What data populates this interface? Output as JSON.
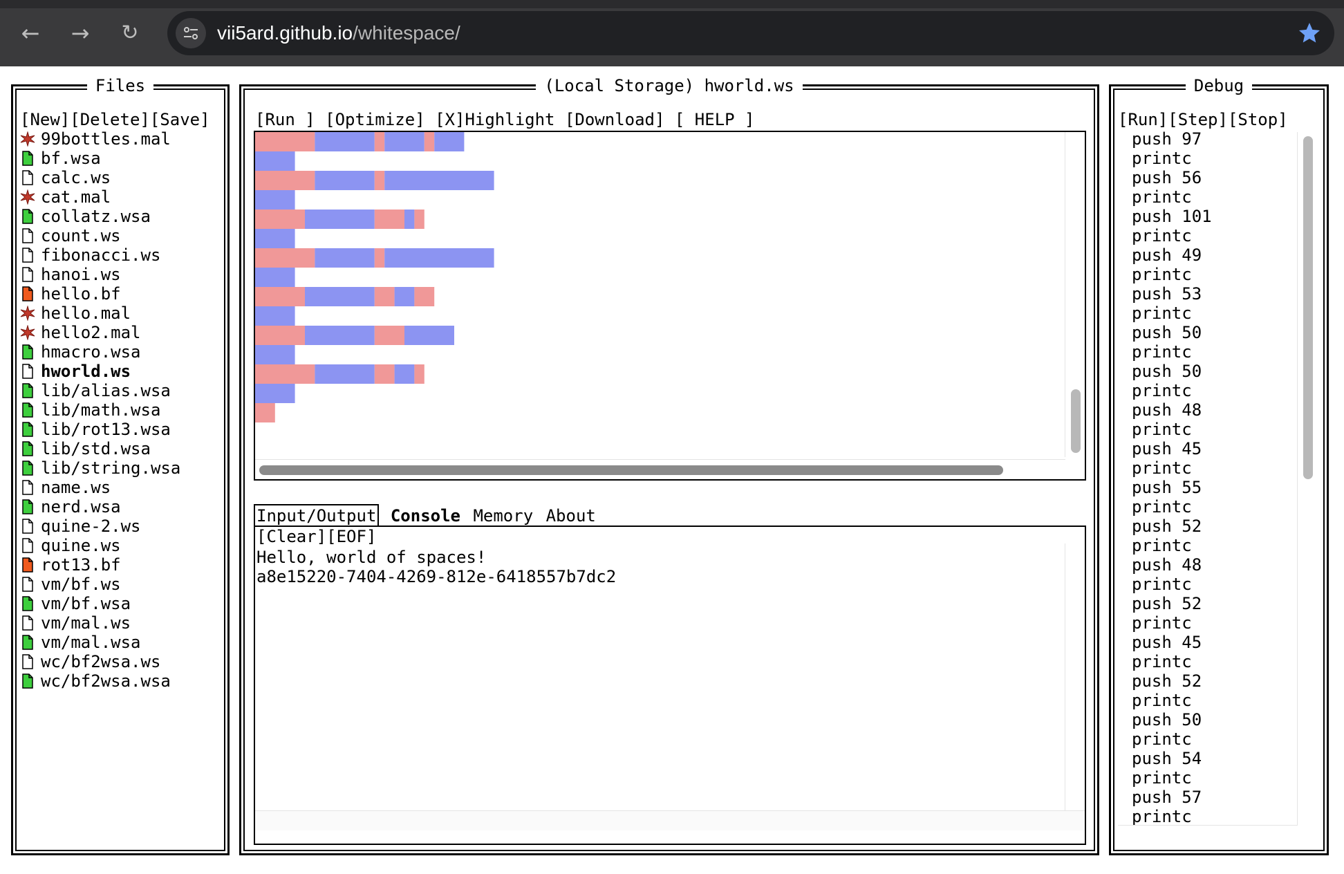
{
  "browser": {
    "url_host": "vii5ard.github.io",
    "url_path": "/whitespace/"
  },
  "files_panel": {
    "title": "Files",
    "toolbar": {
      "new": "[New]",
      "delete": "[Delete]",
      "save": "[Save]"
    },
    "items": [
      {
        "name": "99bottles.mal",
        "icon": "mal-star-icon"
      },
      {
        "name": "bf.wsa",
        "icon": "green-file-icon"
      },
      {
        "name": "calc.ws",
        "icon": "blank-file-icon"
      },
      {
        "name": "cat.mal",
        "icon": "mal-star-icon"
      },
      {
        "name": "collatz.wsa",
        "icon": "green-file-icon"
      },
      {
        "name": "count.ws",
        "icon": "blank-file-icon"
      },
      {
        "name": "fibonacci.ws",
        "icon": "blank-file-icon"
      },
      {
        "name": "hanoi.ws",
        "icon": "blank-file-icon"
      },
      {
        "name": "hello.bf",
        "icon": "orange-file-icon"
      },
      {
        "name": "hello.mal",
        "icon": "mal-star-icon"
      },
      {
        "name": "hello2.mal",
        "icon": "mal-star-icon"
      },
      {
        "name": "hmacro.wsa",
        "icon": "green-file-icon"
      },
      {
        "name": "hworld.ws",
        "icon": "blank-file-icon",
        "active": true
      },
      {
        "name": "lib/alias.wsa",
        "icon": "green-file-icon"
      },
      {
        "name": "lib/math.wsa",
        "icon": "green-file-icon"
      },
      {
        "name": "lib/rot13.wsa",
        "icon": "green-file-icon"
      },
      {
        "name": "lib/std.wsa",
        "icon": "green-file-icon"
      },
      {
        "name": "lib/string.wsa",
        "icon": "green-file-icon"
      },
      {
        "name": "name.ws",
        "icon": "blank-file-icon"
      },
      {
        "name": "nerd.wsa",
        "icon": "green-file-icon"
      },
      {
        "name": "quine-2.ws",
        "icon": "blank-file-icon"
      },
      {
        "name": "quine.ws",
        "icon": "blank-file-icon"
      },
      {
        "name": "rot13.bf",
        "icon": "orange-file-icon"
      },
      {
        "name": "vm/bf.ws",
        "icon": "blank-file-icon"
      },
      {
        "name": "vm/bf.wsa",
        "icon": "green-file-icon"
      },
      {
        "name": "vm/mal.ws",
        "icon": "blank-file-icon"
      },
      {
        "name": "vm/mal.wsa",
        "icon": "green-file-icon"
      },
      {
        "name": "wc/bf2wsa.ws",
        "icon": "blank-file-icon"
      },
      {
        "name": "wc/bf2wsa.wsa",
        "icon": "green-file-icon"
      }
    ]
  },
  "editor_panel": {
    "title": "(Local Storage) hworld.ws",
    "toolbar": {
      "run": "[Run ]",
      "optimize": "[Optimize]",
      "highlight": "[X]Highlight",
      "download": "[Download]",
      "help": "[ HELP ]"
    },
    "colors": {
      "space": "#f09898",
      "tab": "#8c94f2"
    },
    "code_lines": [
      [
        "S6",
        "T6",
        "S1",
        "T4",
        "S1",
        "T3"
      ],
      [
        "T4"
      ],
      [
        "S6",
        "T6",
        "S1",
        "T11"
      ],
      [
        "T4"
      ],
      [
        "S5",
        "T7",
        "S3",
        "T1",
        "S1"
      ],
      [
        "T4"
      ],
      [
        "S6",
        "T6",
        "S1",
        "T11"
      ],
      [
        "T4"
      ],
      [
        "S5",
        "T7",
        "S2",
        "T2",
        "S2"
      ],
      [
        "T4"
      ],
      [
        "S5",
        "T7",
        "S3",
        "T5"
      ],
      [
        "T4"
      ],
      [
        "S6",
        "T6",
        "S2",
        "T2",
        "S1"
      ],
      [
        "T4"
      ],
      [
        "S2"
      ]
    ],
    "tabs": [
      {
        "label": "Input/Output",
        "style": "boxed"
      },
      {
        "label": "Console",
        "style": "bold"
      },
      {
        "label": "Memory",
        "style": "plain"
      },
      {
        "label": "About",
        "style": "plain"
      }
    ],
    "io_toolbar": {
      "clear": "[Clear]",
      "eof": "[EOF]"
    },
    "output_lines": [
      "Hello, world of spaces!",
      "a8e15220-7404-4269-812e-6418557b7dc2"
    ]
  },
  "debug_panel": {
    "title": "Debug",
    "toolbar": {
      "run": "[Run]",
      "step": "[Step]",
      "stop": "[Stop]"
    },
    "instructions": [
      "push 97",
      "printc",
      "push 56",
      "printc",
      "push 101",
      "printc",
      "push 49",
      "printc",
      "push 53",
      "printc",
      "push 50",
      "printc",
      "push 50",
      "printc",
      "push 48",
      "printc",
      "push 45",
      "printc",
      "push 55",
      "printc",
      "push 52",
      "printc",
      "push 48",
      "printc",
      "push 52",
      "printc",
      "push 45",
      "printc",
      "push 52",
      "printc",
      "push 50",
      "printc",
      "push 54",
      "printc",
      "push 57",
      "printc"
    ]
  }
}
